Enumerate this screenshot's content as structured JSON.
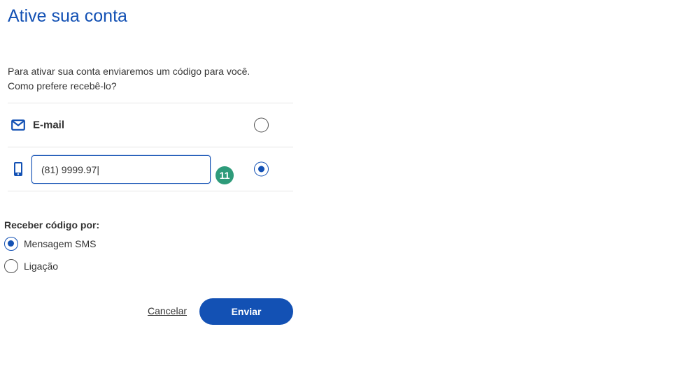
{
  "page": {
    "title": "Ative sua conta",
    "intro_line1": "Para ativar sua conta enviaremos um código para você.",
    "intro_line2": "Como prefere recebê-lo?"
  },
  "contact_options": {
    "email": {
      "label": "E-mail",
      "icon": "envelope-icon",
      "selected": false
    },
    "phone": {
      "icon": "mobile-phone-icon",
      "value": "(81) 9999.97|",
      "counter": "11",
      "selected": true
    }
  },
  "receive": {
    "label": "Receber código por:",
    "options": [
      {
        "label": "Mensagem SMS",
        "selected": true
      },
      {
        "label": "Ligação",
        "selected": false
      }
    ]
  },
  "actions": {
    "cancel_label": "Cancelar",
    "send_label": "Enviar"
  },
  "colors": {
    "primary": "#1351b4",
    "badge": "#2e9b7a",
    "text": "#333333",
    "divider": "#e6e6e6"
  }
}
